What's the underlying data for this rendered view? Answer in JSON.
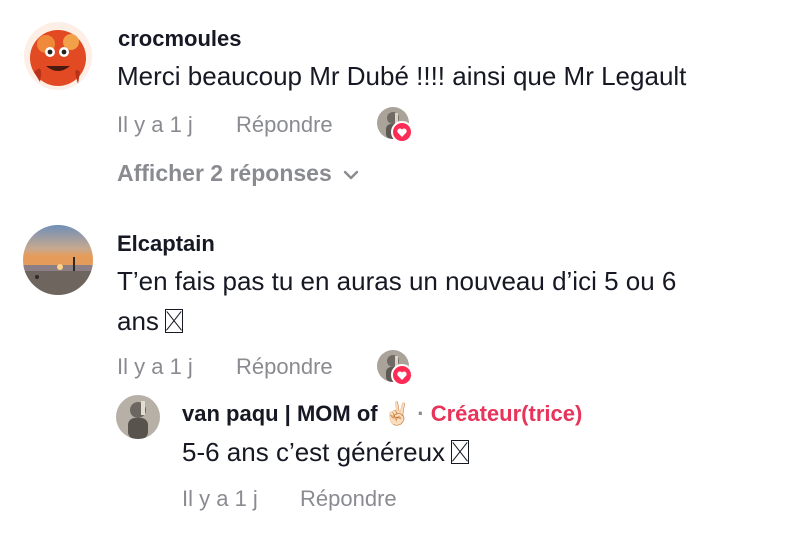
{
  "comments": [
    {
      "username": "crocmoules",
      "text": "Merci beaucoup Mr Dubé !!!! ainsi que Mr Legault",
      "time": "Il y a 1 j",
      "reply_label": "Répondre",
      "show_replies_label": "Afficher 2 réponses"
    },
    {
      "username": "Elcaptain",
      "text_line1": "T’en fais pas tu en auras un nouveau d’ici 5 ou 6",
      "text_line2": "ans",
      "time": "Il y a 1 j",
      "reply_label": "Répondre",
      "replies": [
        {
          "username": "van paqu | MOM of ✌🏻",
          "separator": "·",
          "creator_badge": "Créateur(trice)",
          "text": "5-6 ans c’est généreux",
          "time": "Il y a 1 j",
          "reply_label": "Répondre"
        }
      ]
    }
  ],
  "icons": {
    "liked_by_creator": "heart-icon",
    "show_replies_chevron": "chevron-down-icon",
    "missing_emoji": "missing-glyph-icon"
  },
  "colors": {
    "text": "#161823",
    "meta": "#8a8b91",
    "creator": "#e8335a",
    "heart": "#fe2c55"
  }
}
